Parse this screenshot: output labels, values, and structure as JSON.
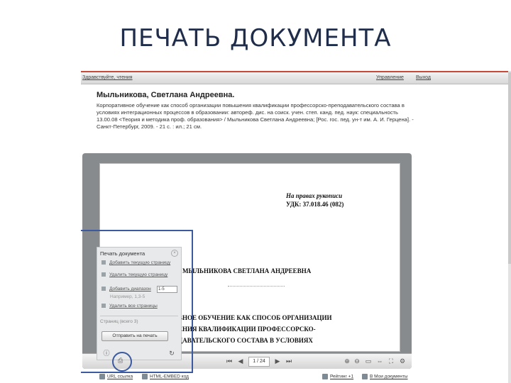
{
  "slide": {
    "title": "ПЕЧАТЬ ДОКУМЕНТА"
  },
  "topbar": {
    "greeting": "Здравствуйте, чтения",
    "manage": "Управление",
    "exit": "Выход"
  },
  "record": {
    "author": "Мыльникова, Светлана Андреевна.",
    "description": "Корпоративное обучение как способ организации повышения квалификации профессорско-преподавательского состава в условиях интеграционных процессов в образовании: автореф. дис. на соиск. учен. степ. канд. пед. наук: специальность 13.00.08 <Теория и методика проф. образования> / Мыльникова Светлана Андреевна; [Рос. гос. пед. ун-т им. А. И. Герцена]. - Санкт-Петербург, 2009. - 21 с. : ил.; 21 см."
  },
  "document": {
    "line1": "На правах рукописи",
    "line2": "УДК: 37.018.46 (082)",
    "author_upper": "МЫЛЬНИКОВА СВЕТЛАНА АНДРЕЕВНА",
    "title_lines": [
      "ВНОЕ ОБУЧЕНИЕ КАК СПОСОБ ОРГАНИЗАЦИИ",
      "ЕНИЯ КВАЛИФИКАЦИИ ПРОФЕССОРСКО-",
      "ДАВАТЕЛЬСКОГО СОСТАВА В УСЛОВИЯХ"
    ]
  },
  "viewer": {
    "page_indicator": "1 / 24"
  },
  "print_panel": {
    "title": "Печать документа",
    "items": [
      "Добавить текущую страницу",
      "Удалить текущую страницу",
      "Добавить диапазон",
      "Удалить все страницы"
    ],
    "range_value": "1-5",
    "example": "Например, 1,3-5",
    "pages_count": "Страниц (всего 3)",
    "send_button": "Отправить на печать"
  },
  "bottom": {
    "url_link": "URL ссылка",
    "embed_link": "HTML-EMBED код",
    "rating": "Рейтинг +1",
    "my_docs": "В Мои документы"
  }
}
